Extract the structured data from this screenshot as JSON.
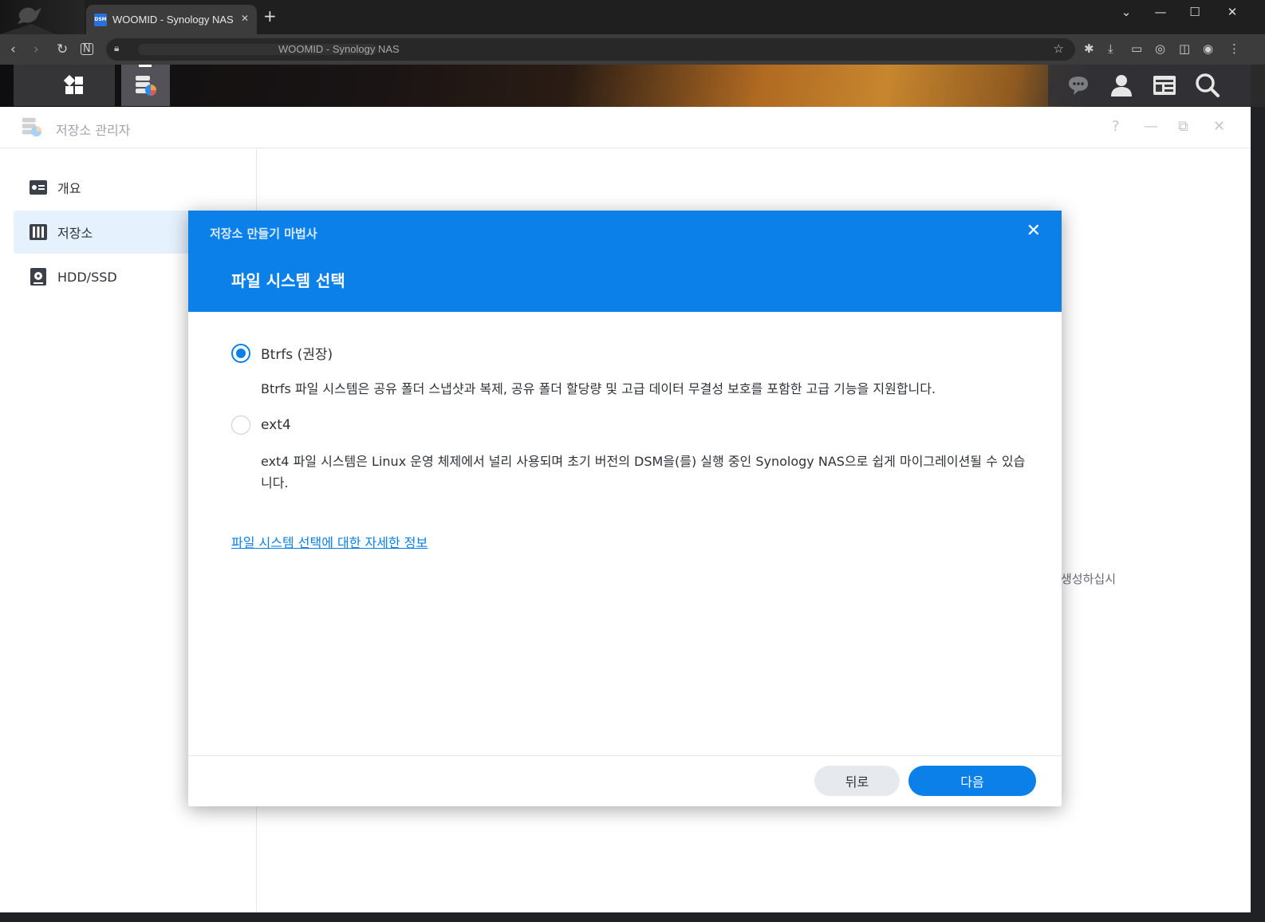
{
  "browser": {
    "tab_title": "WOOMID - Synology NAS",
    "favicon_text": "DSM",
    "url": "WOOMID - Synology NAS",
    "new_tab": "+",
    "window_controls": [
      "⌄",
      "—",
      "☐",
      "✕"
    ]
  },
  "dsm_taskbar": {
    "left_icon": "main-menu-grid-icon",
    "active_app_icon": "storage-manager-icon",
    "right_icons": [
      "notification-chat-icon",
      "user-icon",
      "widgets-icon",
      "search-icon"
    ]
  },
  "window": {
    "title": "저장소 관리자",
    "controls": [
      "?",
      "—",
      "⧉",
      "✕"
    ],
    "background_hint": "생성하십시",
    "sidebar": [
      {
        "label": "개요",
        "icon": "overview-icon",
        "active": false
      },
      {
        "label": "저장소",
        "icon": "storage-icon",
        "active": true
      },
      {
        "label": "HDD/SSD",
        "icon": "drive-icon",
        "active": false
      }
    ]
  },
  "modal": {
    "wizard_title": "저장소 만들기 마법사",
    "step_title": "파일 시스템 선택",
    "close": "✕",
    "options": [
      {
        "label": "Btrfs (권장)",
        "selected": true,
        "description": "Btrfs 파일 시스템은 공유 폴더 스냅샷과 복제, 공유 폴더 할당량 및 고급 데이터 무결성 보호를 포함한 고급 기능을 지원합니다."
      },
      {
        "label": "ext4",
        "selected": false,
        "description": "ext4 파일 시스템은 Linux 운영 체제에서 널리 사용되며 초기 버전의 DSM을(를) 실행 중인 Synology NAS으로 쉽게 마이그레이션될 수 있습니다."
      }
    ],
    "more_link": "파일 시스템 선택에 대한 자세한 정보",
    "buttons": {
      "back": "뒤로",
      "next": "다음"
    }
  },
  "colors": {
    "accent": "#0a80e8",
    "sidebar_active": "#e5f1fd"
  }
}
